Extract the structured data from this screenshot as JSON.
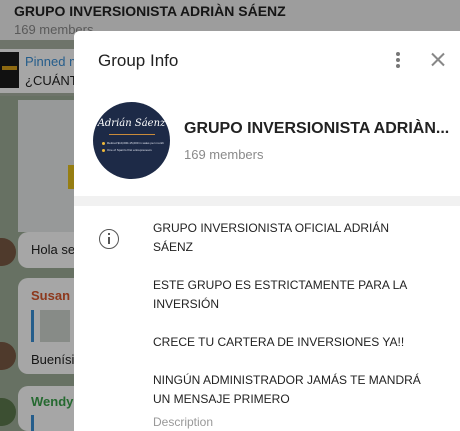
{
  "chat": {
    "title": "GRUPO INVERSIONISTA ADRIÀN SÁENZ",
    "members": "169 members",
    "pinned_label": "Pinned m",
    "pinned_preview": "¿CUÁNT",
    "messages": [
      {
        "text": "Hola se"
      },
      {
        "sender": "Susan B",
        "sender_color": "#d9572b",
        "text": "Buenísi"
      },
      {
        "sender": "Wendy",
        "sender_color": "#3aa14a"
      }
    ]
  },
  "panel": {
    "title": "Group Info",
    "more_icon": "more-vertical-icon",
    "close_icon": "close-icon",
    "avatar_text": "Adrián Sáenz",
    "avatar_lines": [
      "Retired $10,000-15,000 in sales per month",
      "One of Spain's first entrepreneurs"
    ],
    "group_name": "GRUPO INVERSIONISTA ADRIÀN...",
    "members": "169 members",
    "description_lines": [
      "GRUPO INVERSIONISTA OFICIAL ADRIÁN",
      "SÁENZ",
      "ESTE GRUPO ES ESTRICTAMENTE PARA LA",
      "INVERSIÓN",
      "CRECE TU CARTERA DE INVERSIONES YA!!",
      "NINGÚN ADMINISTRADOR JAMÁS TE MANDRÁ",
      "UN MENSAJE PRIMERO"
    ],
    "description_label": "Description",
    "info_icon": "info-icon"
  }
}
